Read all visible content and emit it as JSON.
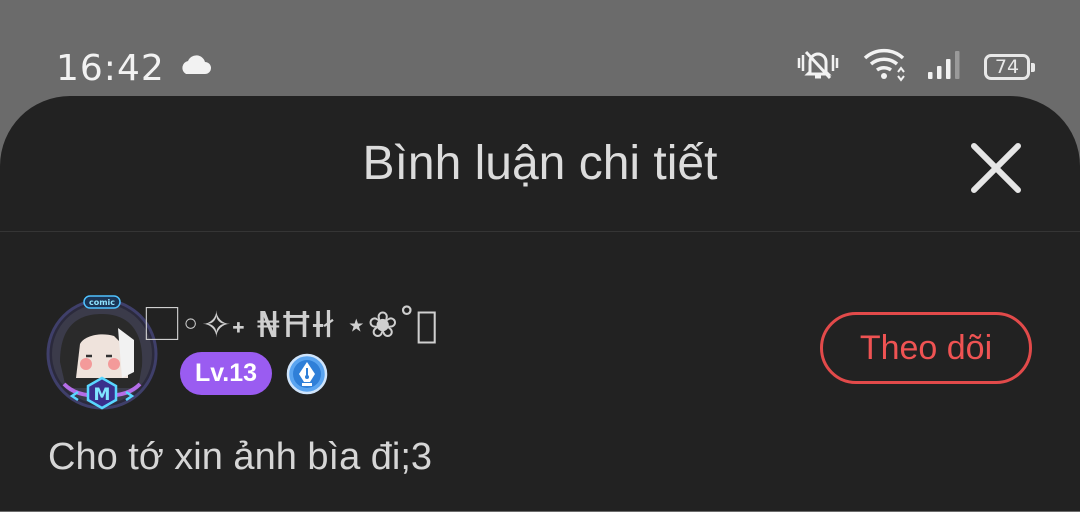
{
  "status_bar": {
    "time": "16:42",
    "battery": "74",
    "icons": [
      "cloud-icon",
      "vibrate-mute-icon",
      "wifi-icon",
      "signal-icon",
      "battery-icon"
    ]
  },
  "sheet": {
    "title": "Bình luận chi tiết",
    "close_icon": "close-icon"
  },
  "comment": {
    "username": "⃞◦✧˖ ₦ĦƗł ⋆❀˚⃞",
    "level": "Lv.13",
    "follow_label": "Theo dõi",
    "text": "Cho tớ xin ảnh bìa đi;3",
    "avatar_badge": "comic",
    "avatar_letter": "M"
  },
  "colors": {
    "sheet_bg": "#222222",
    "backdrop": "#6b6b6b",
    "level_badge": "#9a5cf1",
    "follow_accent": "#e24a4a",
    "writer_badge": "#3b8fe8"
  }
}
